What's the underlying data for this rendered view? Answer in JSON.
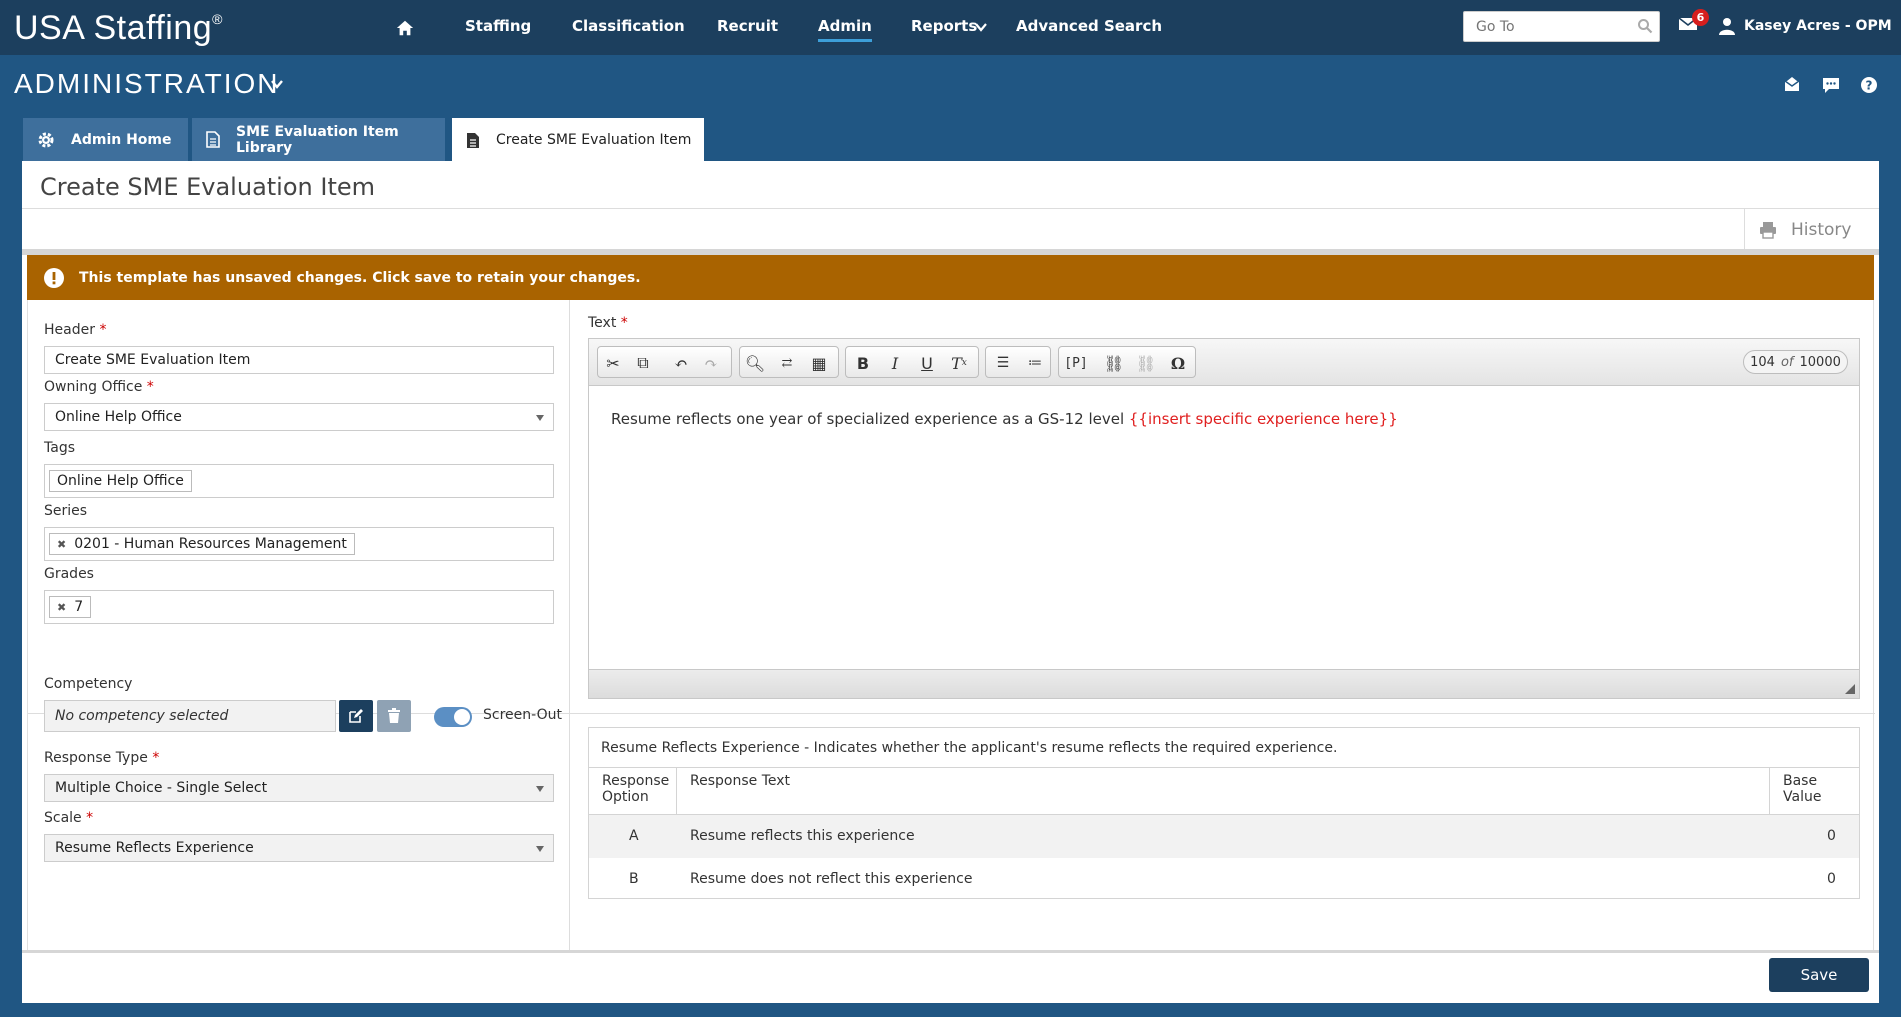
{
  "app": {
    "logo": "USA Staffing",
    "logo_mark": "®"
  },
  "nav": {
    "items": [
      "Staffing",
      "Classification",
      "Recruit",
      "Admin",
      "Reports",
      "Advanced Search"
    ],
    "active": "Admin",
    "goto_placeholder": "Go To",
    "mail_count": "6",
    "user": "Kasey Acres - OPM"
  },
  "section": {
    "title": "ADMINISTRATION"
  },
  "tabs": [
    {
      "label": "Admin Home",
      "icon": "gear-icon"
    },
    {
      "label": "SME Evaluation Item Library",
      "icon": "document-icon"
    },
    {
      "label": "Create SME Evaluation Item",
      "icon": "document-icon",
      "active": true
    }
  ],
  "page": {
    "title": "Create SME Evaluation Item",
    "history_label": "History",
    "warning": "This template has unsaved changes. Click save to retain your changes."
  },
  "form": {
    "header_label": "Header",
    "header_value": "Create SME Evaluation Item",
    "office_label": "Owning Office",
    "office_value": "Online Help Office",
    "tags_label": "Tags",
    "tags": [
      "Online Help Office"
    ],
    "series_label": "Series",
    "series": [
      "0201 - Human Resources Management"
    ],
    "grades_label": "Grades",
    "grades": [
      "7"
    ],
    "competency_label": "Competency",
    "competency_value": "No competency selected",
    "screen_out_label": "Screen-Out",
    "screen_out_on": true,
    "response_type_label": "Response Type",
    "response_type_value": "Multiple Choice - Single Select",
    "scale_label": "Scale",
    "scale_value": "Resume Reflects Experience",
    "required_mark": "*"
  },
  "editor": {
    "label": "Text",
    "count": "104",
    "count_of": "of",
    "max": "10000",
    "text": "Resume reflects one year of specialized experience as a GS-12 level ",
    "placeholder_text": "{{insert specific experience here}}"
  },
  "response_table": {
    "title": "Resume Reflects Experience -  Indicates whether the applicant's resume reflects the required experience.",
    "col_option_1": "Response",
    "col_option_2": "Option",
    "col_text": "Response Text",
    "col_value_1": "Base",
    "col_value_2": "Value",
    "rows": [
      {
        "option": "A",
        "text": "Resume reflects this experience",
        "value": "0"
      },
      {
        "option": "B",
        "text": "Resume does not reflect this experience",
        "value": "0"
      }
    ]
  },
  "footer": {
    "save_label": "Save"
  },
  "colors": {
    "nav": "#1c3f5e",
    "background": "#205683",
    "warning": "#a96300",
    "required": "#cc0000",
    "placeholder": "#e02020",
    "primary_button": "#1c3f5e"
  }
}
